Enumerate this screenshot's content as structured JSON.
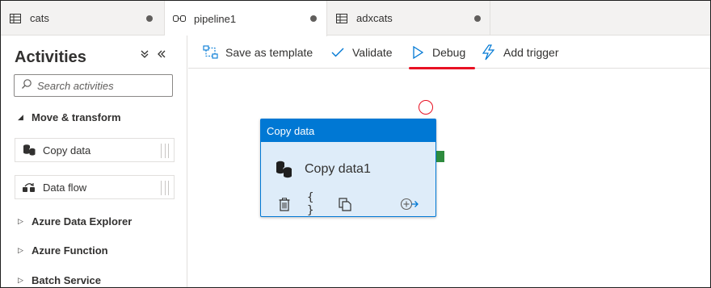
{
  "tabs": [
    {
      "label": "cats",
      "icon": "table-icon",
      "active": false
    },
    {
      "label": "pipeline1",
      "icon": "pipeline-icon",
      "active": true
    },
    {
      "label": "adxcats",
      "icon": "table-icon",
      "active": false
    }
  ],
  "sidebar": {
    "title": "Activities",
    "collapse_glyph": "»",
    "close_glyph": "«",
    "search_placeholder": "Search activities",
    "sections": [
      {
        "label": "Move & transform",
        "expanded": true
      },
      {
        "label": "Azure Data Explorer",
        "expanded": false
      },
      {
        "label": "Azure Function",
        "expanded": false
      },
      {
        "label": "Batch Service",
        "expanded": false
      }
    ],
    "activities": [
      {
        "label": "Copy data",
        "icon": "copy-data-icon"
      },
      {
        "label": "Data flow",
        "icon": "data-flow-icon"
      }
    ]
  },
  "toolbar": {
    "save_template": "Save as template",
    "validate": "Validate",
    "debug": "Debug",
    "add_trigger": "Add trigger"
  },
  "node": {
    "header": "Copy data",
    "name": "Copy data1"
  },
  "colors": {
    "accent": "#0078d4",
    "node_fill": "#deecf9",
    "highlight": "#e81123",
    "success_handle": "#2e8b3e"
  }
}
